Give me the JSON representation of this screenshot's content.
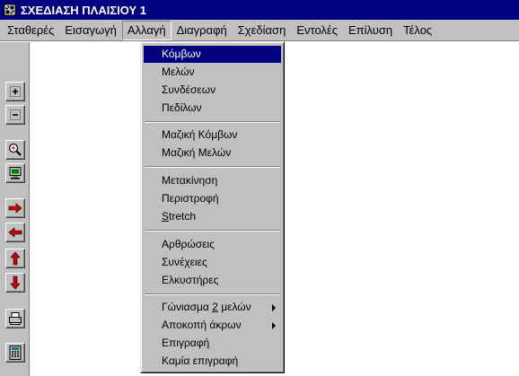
{
  "window": {
    "title": "ΣΧΕΔΙΑΣΗ ΠΛΑΙΣΙΟΥ 1",
    "icon": "app-grid-icon"
  },
  "menubar": {
    "items": [
      {
        "label": "Σταθερές"
      },
      {
        "label": "Εισαγωγή"
      },
      {
        "label": "Αλλαγή",
        "open": true
      },
      {
        "label": "Διαγραφή"
      },
      {
        "label": "Σχεδίαση"
      },
      {
        "label": "Εντολές"
      },
      {
        "label": "Επίλυση"
      },
      {
        "label": "Τέλος"
      }
    ]
  },
  "dropdown": {
    "items": [
      {
        "label": "Κόμβων",
        "selected": true
      },
      {
        "label": "Μελών"
      },
      {
        "label": "Συνδέσεων"
      },
      {
        "label": "Πεδίλων"
      },
      {
        "label": "Μαζική Κόμβων"
      },
      {
        "label": "Μαζική Μελών"
      },
      {
        "label": "Μετακίνηση"
      },
      {
        "label": "Περιστροφή"
      },
      {
        "label": "Stretch",
        "mnemonic": "S",
        "rest": "tretch"
      },
      {
        "label": "Αρθρώσεις"
      },
      {
        "label": "Συνέχειες"
      },
      {
        "label": "Ελκυστήρες"
      },
      {
        "label": "Γώνιασμα 2 μελών",
        "before": "Γώνιασμα ",
        "mnemonic": "2",
        "after": " μελών",
        "submenu": true
      },
      {
        "label": "Αποκοπή άκρων",
        "submenu": true
      },
      {
        "label": "Επιγραφή"
      },
      {
        "label": "Καμία επιγραφή"
      }
    ]
  },
  "toolbar": {
    "buttons": [
      {
        "icon": "zoom-in-plus-icon"
      },
      {
        "icon": "zoom-out-minus-icon"
      },
      {
        "icon": "magnifier-icon"
      },
      {
        "icon": "monitor-icon"
      },
      {
        "icon": "arrow-right-icon"
      },
      {
        "icon": "arrow-left-icon"
      },
      {
        "icon": "arrow-up-icon"
      },
      {
        "icon": "arrow-down-icon"
      },
      {
        "icon": "printer-icon"
      },
      {
        "icon": "calculator-icon"
      }
    ]
  },
  "colors": {
    "titlebar": "#000080",
    "face": "#c0c0c0",
    "highlight": "#000080",
    "icon_red": "#d00000"
  }
}
